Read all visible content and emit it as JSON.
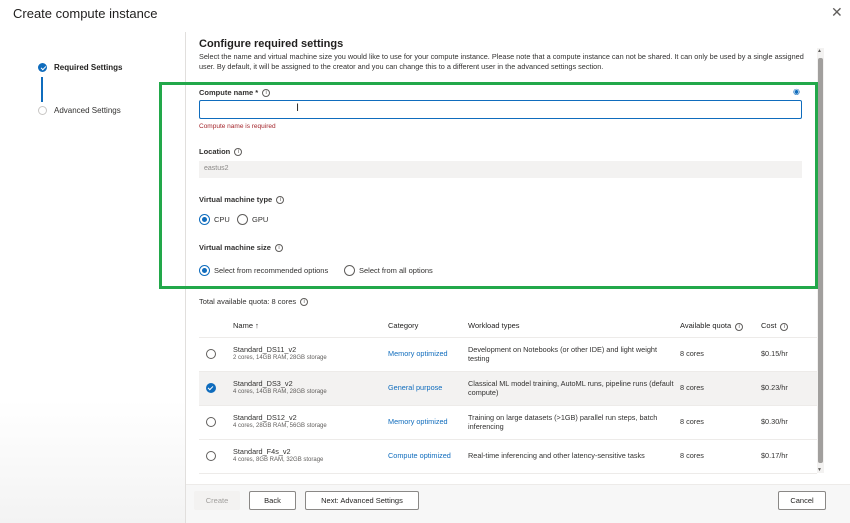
{
  "window": {
    "title": "Create compute instance",
    "close_icon": "close-icon"
  },
  "steps": [
    {
      "label": "Required Settings",
      "state": "complete"
    },
    {
      "label": "Advanced Settings",
      "state": "pending"
    }
  ],
  "section": {
    "title": "Configure required settings",
    "description": "Select the name and virtual machine size you would like to use for your compute instance. Please note that a compute instance can not be shared. It can only be used by a single assigned user. By default, it will be assigned to the creator and you can change this to a different user in the advanced settings section."
  },
  "compute_name": {
    "label": "Compute name *",
    "value": "",
    "error": "Compute name is required"
  },
  "location": {
    "label": "Location",
    "value": "eastus2"
  },
  "vm_type": {
    "label": "Virtual machine type",
    "options": [
      "CPU",
      "GPU"
    ],
    "selected": "CPU"
  },
  "vm_size": {
    "label": "Virtual machine size",
    "options": [
      "Select from recommended options",
      "Select from all options"
    ],
    "selected": "Select from recommended options"
  },
  "quota": {
    "label": "Total available quota: 8 cores"
  },
  "table": {
    "headers": {
      "name": "Name ↑",
      "category": "Category",
      "workload": "Workload types",
      "quota": "Available quota",
      "cost": "Cost"
    },
    "rows": [
      {
        "name": "Standard_DS11_v2",
        "specs": "2 cores, 14GB RAM, 28GB storage",
        "category": "Memory optimized",
        "workload": "Development on Notebooks (or other IDE) and light weight testing",
        "quota": "8 cores",
        "cost": "$0.15/hr",
        "selected": false
      },
      {
        "name": "Standard_DS3_v2",
        "specs": "4 cores, 14GB RAM, 28GB storage",
        "category": "General purpose",
        "workload": "Classical ML model training, AutoML runs, pipeline runs (default compute)",
        "quota": "8 cores",
        "cost": "$0.23/hr",
        "selected": true
      },
      {
        "name": "Standard_DS12_v2",
        "specs": "4 cores, 28GB RAM, 56GB storage",
        "category": "Memory optimized",
        "workload": "Training on large datasets (>1GB) parallel run steps, batch inferencing",
        "quota": "8 cores",
        "cost": "$0.30/hr",
        "selected": false
      },
      {
        "name": "Standard_F4s_v2",
        "specs": "4 cores, 8GB RAM, 32GB storage",
        "category": "Compute optimized",
        "workload": "Real-time inferencing and other latency-sensitive tasks",
        "quota": "8 cores",
        "cost": "$0.17/hr",
        "selected": false
      }
    ]
  },
  "footer": {
    "create": "Create",
    "back": "Back",
    "next": "Next: Advanced Settings",
    "cancel": "Cancel"
  },
  "colors": {
    "accent": "#0f6cbd",
    "highlight": "#22a84a",
    "error": "#a4262c"
  }
}
